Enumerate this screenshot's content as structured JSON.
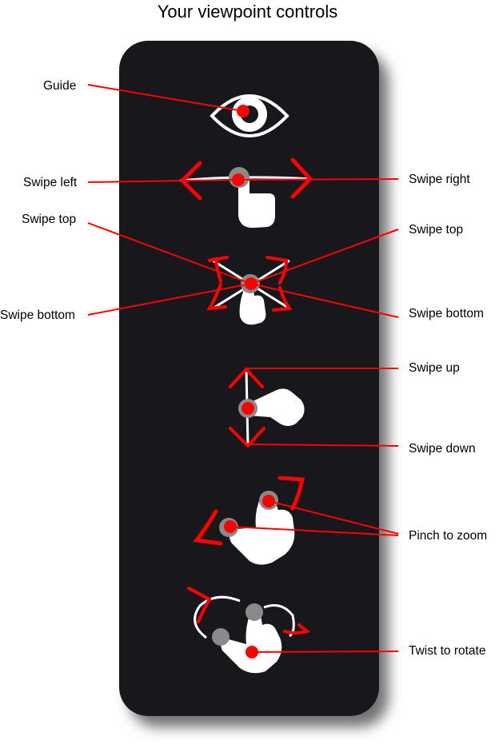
{
  "title": "Your viewpoint controls",
  "labels": {
    "guide": "Guide",
    "swipe_left": "Swipe left",
    "swipe_right": "Swipe right",
    "swipe_top_left": "Swipe top",
    "swipe_top_right": "Swipe top",
    "swipe_bottom_left": "Swipe bottom",
    "swipe_bottom_right": "Swipe bottom",
    "swipe_up": "Swipe up",
    "swipe_down": "Swipe down",
    "pinch_to_zoom": "Pinch to zoom",
    "twist_to_rotate": "Twist to rotate"
  },
  "icons": [
    "eye-icon",
    "hand-swipe-horizontal-icon",
    "hand-swipe-diagonal-icon",
    "hand-swipe-vertical-icon",
    "hand-pinch-icon",
    "hand-twist-icon"
  ],
  "colors": {
    "accent": "#ff0000",
    "panel": "#18181c",
    "icon": "#ffffff",
    "touch_ring": "#8a8a8a"
  }
}
